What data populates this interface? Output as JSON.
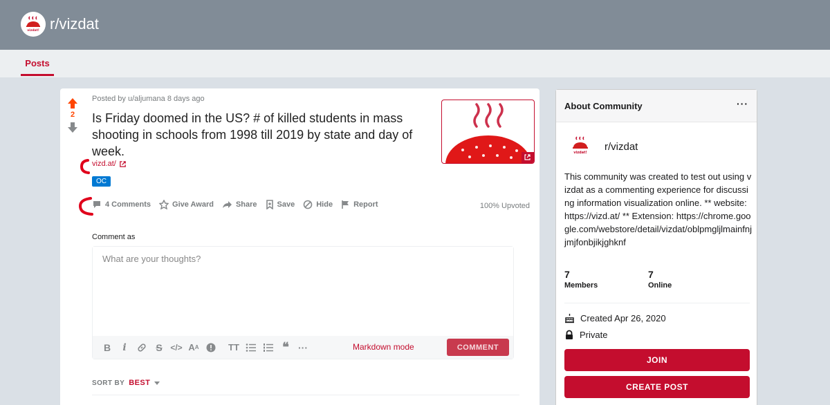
{
  "header": {
    "subreddit": "r/vizdat"
  },
  "tabs": {
    "posts": "Posts"
  },
  "post": {
    "vote_count": "2",
    "byline": "Posted by u/aljumana 8 days ago",
    "title": "Is Friday doomed in the US? # of killed students in mass shooting in schools from 1998 till 2019 by state and day of week.",
    "link_text": "vizd.at/",
    "flair": "OC",
    "actions": {
      "comments": "4 Comments",
      "award": "Give Award",
      "share": "Share",
      "save": "Save",
      "hide": "Hide",
      "report": "Report"
    },
    "upvoted": "100% Upvoted"
  },
  "comment_box": {
    "label": "Comment as",
    "placeholder": "What are your thoughts?",
    "markdown_mode": "Markdown mode",
    "submit": "COMMENT"
  },
  "sort": {
    "label": "SORT BY",
    "value": "BEST"
  },
  "sidebar": {
    "title": "About Community",
    "name": "r/vizdat",
    "description": "This community was created to test out using vizdat as a commenting experience for discussing information visualization online. ** website: https://vizd.at/ ** Extension: https://chrome.google.com/webstore/detail/vizdat/oblpmgljlmainfnjjmjfonbjikjghknf",
    "members_count": "7",
    "members_label": "Members",
    "online_count": "7",
    "online_label": "Online",
    "created": "Created Apr 26, 2020",
    "privacy": "Private",
    "join": "JOIN",
    "create_post": "CREATE POST"
  },
  "logo_text": "vizdat!",
  "colors": {
    "accent": "#c40d2e",
    "header_bg": "#818c97",
    "page_bg": "#dae0e6",
    "upvote": "#ff4500"
  }
}
